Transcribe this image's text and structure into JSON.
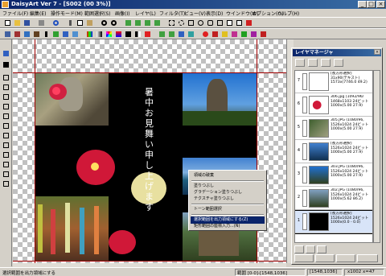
{
  "window": {
    "title": "DaisyArt Ver 7 - [S002 (00 3%)]",
    "controls": [
      "_",
      "□",
      "×"
    ]
  },
  "menubar": {
    "items": [
      "ファイル(F)",
      "編集(E)",
      "操作モード(M)",
      "範囲選択(S)",
      "画像(I)",
      "レイヤ(L)",
      "フィルタ(T)",
      "ビュー(V)",
      "表示(D)",
      "ウインドウ(W)",
      "オプション(O)",
      "ヘルプ(H)"
    ]
  },
  "artwork": {
    "vertical_text": [
      "暑中お見舞い申し上げます"
    ]
  },
  "context_menu": {
    "items": [
      {
        "label": "領域の破棄",
        "state": "normal"
      },
      {
        "label": "---"
      },
      {
        "label": "塗りつぶし",
        "state": "normal"
      },
      {
        "label": "グラデーション塗りつぶし",
        "state": "normal"
      },
      {
        "label": "テクスチャ塗りつぶし",
        "state": "normal"
      },
      {
        "label": "---"
      },
      {
        "label": "トーン範囲選択",
        "state": "normal"
      },
      {
        "label": "---"
      },
      {
        "label": "選択範囲を出力領域にする(Z)",
        "state": "selected"
      },
      {
        "label": "矩形範囲の座標入力...(N)",
        "state": "normal"
      }
    ]
  },
  "layer_panel": {
    "title": "レイヤマネージャ",
    "close": "×",
    "layers": [
      {
        "num": "7",
        "lines": [
          "[長方形選択]",
          "31x90(テキスト)",
          "1573x(7746.0 49.2)"
        ]
      },
      {
        "num": "6",
        "lines": [
          "306.jpg [1092/96/",
          "1468x1103 24ビット",
          "1000x(5.00 27.9)"
        ]
      },
      {
        "num": "5",
        "lines": [
          "305.JPG (1080/96,",
          "1526x1024 24ビット",
          "1000x(5.00 27.9)"
        ]
      },
      {
        "num": "4",
        "lines": [
          "[長方形選択]",
          "1526x1024 24ビット",
          "1000x(5.00 27.9)"
        ]
      },
      {
        "num": "3",
        "lines": [
          "303.JPG (1080/96,",
          "1526x1024 24ビット",
          "1000x(5.00 27.9)"
        ]
      },
      {
        "num": "2",
        "lines": [
          "302.JPG (1080/96,",
          "1526x1024 24ビット",
          "1000x(5.62 86.2)"
        ]
      },
      {
        "num": "1",
        "lines": [
          "[長方形選択]",
          "1526x1024 24ビット",
          "1000x(0.0 - 0.0)"
        ]
      }
    ]
  },
  "statusbar": {
    "message": "選択範囲を出力領域にする",
    "range": "範囲 [0-0]-[1548,1036]",
    "size": "[1548,1036]",
    "zoom": "x1002 x=47"
  },
  "colors": {
    "titlebar": "#0a246a",
    "selection_highlight": "#0a246a",
    "guide": "#a00000"
  }
}
